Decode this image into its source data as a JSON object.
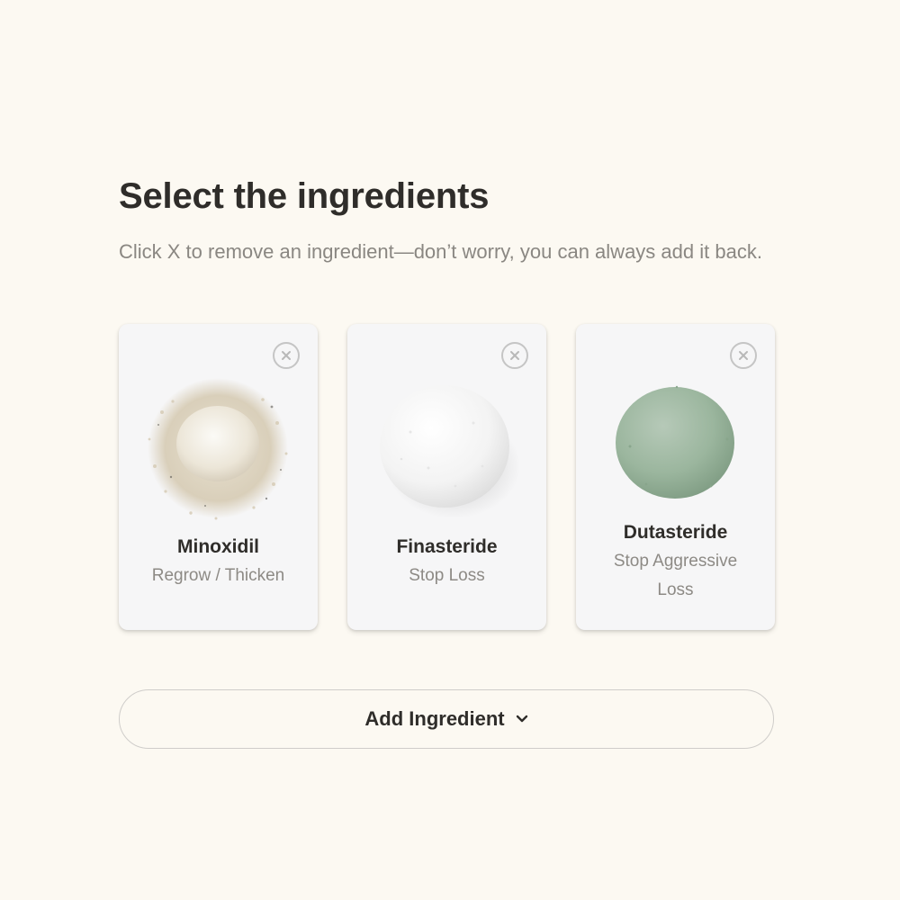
{
  "page": {
    "title": "Select the ingredients",
    "subtitle": "Click X to remove an ingredient—don’t worry, you can always add it back."
  },
  "ingredients": [
    {
      "name": "Minoxidil",
      "description": "Regrow / Thicken",
      "powder_color": "#f1ede3"
    },
    {
      "name": "Finasteride",
      "description": "Stop Loss",
      "powder_color": "#ffffff"
    },
    {
      "name": "Dutasteride",
      "description": "Stop Aggressive Loss",
      "powder_color": "#9cb79f"
    }
  ],
  "add_button": {
    "label": "Add Ingredient",
    "icon": "chevron-down-icon"
  },
  "colors": {
    "background": "#fcf9f2",
    "card": "#f6f6f7",
    "text": "#2f2d2a",
    "muted": "#8a8782"
  }
}
